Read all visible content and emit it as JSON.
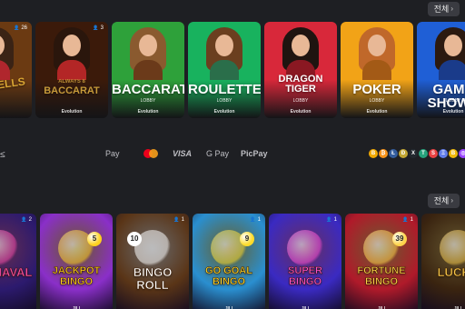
{
  "sections": {
    "live": {
      "see_all_label": "전체",
      "cards": [
        {
          "title": "ALL BELLS",
          "subtitle": "",
          "provider": "",
          "players": "26",
          "bg": "#6b3a12",
          "accent": "#d9a533",
          "hair": "#3a2315",
          "outfit": "#b0262d"
        },
        {
          "title": "BACCARAT",
          "subtitle": "ALWAYS 8",
          "provider": "Evolution",
          "players": "3",
          "bg": "#3b1a0a",
          "accent": "#c69a3a",
          "hair": "#2a160c",
          "outfit": "#b32626"
        },
        {
          "title": "BACCARAT",
          "subtitle": "LOBBY",
          "provider": "Evolution",
          "players": "",
          "bg": "#2ea13a",
          "accent": "#ffffff",
          "hair": "#8a5a2f",
          "outfit": "#6b3a1a"
        },
        {
          "title": "ROULETTE",
          "subtitle": "LOBBY",
          "provider": "Evolution",
          "players": "",
          "bg": "#18b25e",
          "accent": "#ffffff",
          "hair": "#6b3f1f",
          "outfit": "#2a6e4a"
        },
        {
          "title": "DRAGON TIGER",
          "subtitle": "LOBBY",
          "provider": "Evolution",
          "players": "",
          "bg": "#d8283a",
          "accent": "#ffffff",
          "hair": "#1f1410",
          "outfit": "#8a1822"
        },
        {
          "title": "POKER",
          "subtitle": "LOBBY",
          "provider": "Evolution",
          "players": "",
          "bg": "#f2a317",
          "accent": "#ffffff",
          "hair": "#c0682a",
          "outfit": "#a35a16"
        },
        {
          "title": "GAME SHOWS",
          "subtitle": "LOBBY",
          "provider": "Evolution",
          "players": "",
          "bg": "#1f5fd6",
          "accent": "#ffffff",
          "hair": "#2c1a10",
          "outfit": "#1a3b8a"
        }
      ]
    },
    "payments": {
      "left_glyph": "≤",
      "methods": [
        "Pay",
        "",
        "VISA",
        "G Pay",
        "PicPay"
      ],
      "crypto_symbols": [
        "B",
        "₿",
        "Ł",
        "Ð",
        "X",
        "T",
        "S",
        "Ξ",
        "B",
        "◎",
        "T"
      ],
      "crypto_colors": [
        "#f2a900",
        "#f7931a",
        "#345d9d",
        "#c2a633",
        "#23292f",
        "#26a17b",
        "#e84142",
        "#627eea",
        "#f0b90b",
        "#9945ff",
        "#0098ea"
      ]
    },
    "bingo": {
      "see_all_label": "전체",
      "cards": [
        {
          "title": "CARNAVAL",
          "provider": "",
          "players": "2",
          "bg": "#2c1a6e",
          "accent": "#f54aa8",
          "ball": ""
        },
        {
          "title": "JACKPOT BINGO",
          "provider": "JILI",
          "players": "",
          "bg": "#8a2fc9",
          "accent": "#ffd21f",
          "ball": "5"
        },
        {
          "title": "BINGO ROLL",
          "provider": "",
          "players": "1",
          "bg": "#5a3517",
          "accent": "#ffffff",
          "ball": "10"
        },
        {
          "title": "GO GOAL BINGO",
          "provider": "JILI",
          "players": "1",
          "bg": "#2a8fd0",
          "accent": "#ffdc2a",
          "ball": "9"
        },
        {
          "title": "SUPER BINGO",
          "provider": "JILI",
          "players": "1",
          "bg": "#3a2ac2",
          "accent": "#ff4fd2",
          "ball": ""
        },
        {
          "title": "FORTUNE BINGO",
          "provider": "JILI",
          "players": "1",
          "bg": "#b01a2a",
          "accent": "#ffd44a",
          "ball": "39"
        },
        {
          "title": "LUCKY",
          "provider": "JILI",
          "players": "",
          "bg": "#3a2410",
          "accent": "#f3c64a",
          "ball": ""
        }
      ]
    }
  }
}
